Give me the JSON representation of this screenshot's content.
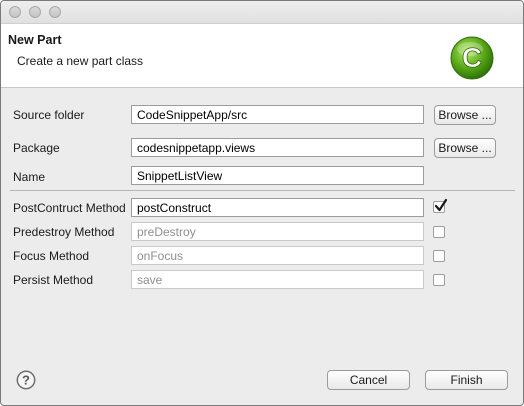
{
  "banner": {
    "title": "New Part",
    "description": "Create a new part class",
    "icon": "class-c-icon",
    "icon_color": "#5aa818"
  },
  "fields": {
    "source_folder": {
      "label": "Source folder",
      "value": "CodeSnippetApp/src",
      "browse_label": "Browse ..."
    },
    "package": {
      "label": "Package",
      "value": "codesnippetapp.views",
      "browse_label": "Browse ..."
    },
    "name": {
      "label": "Name",
      "value": "SnippetListView"
    }
  },
  "methods": {
    "post_construct": {
      "label": "PostContruct Method",
      "value": "postConstruct",
      "checked": true
    },
    "pre_destroy": {
      "label": "Predestroy Method",
      "value": "preDestroy",
      "checked": false
    },
    "focus": {
      "label": "Focus Method",
      "value": "onFocus",
      "checked": false
    },
    "persist": {
      "label": "Persist Method",
      "value": "save",
      "checked": false
    }
  },
  "footer": {
    "cancel_label": "Cancel",
    "finish_label": "Finish",
    "help_icon": "help-icon"
  }
}
